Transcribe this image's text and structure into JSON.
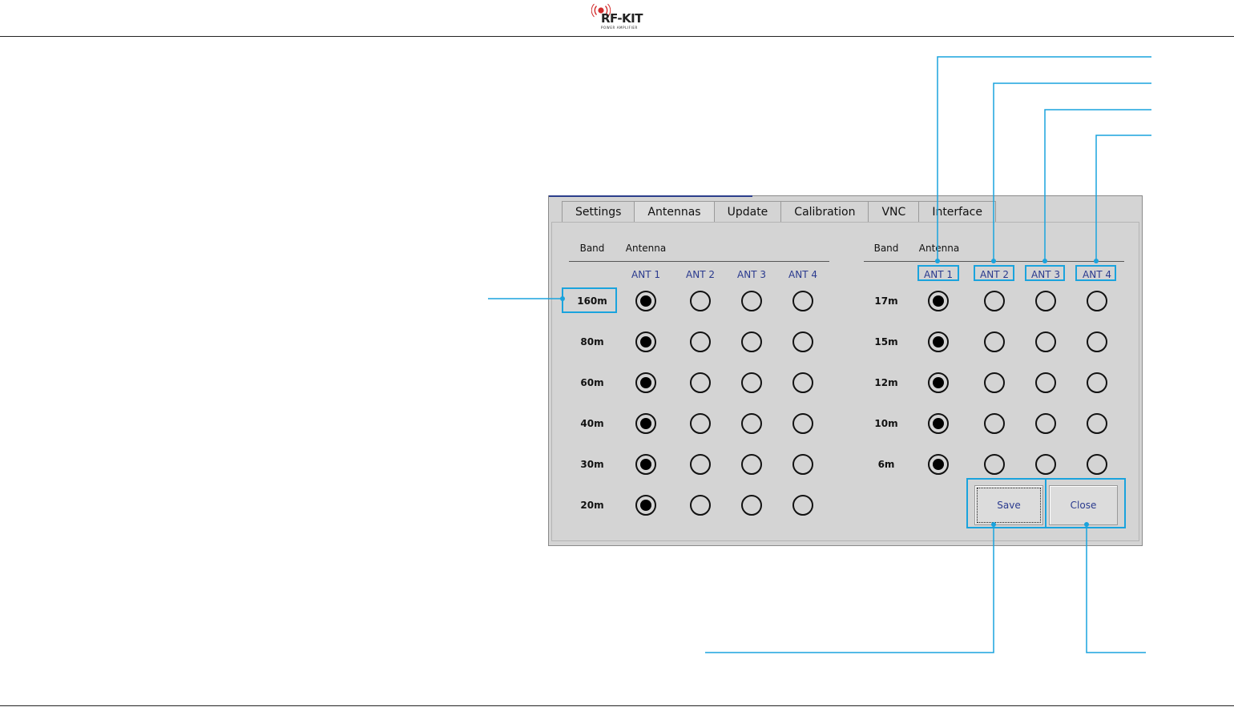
{
  "logo": {
    "brand": "RF-KIT",
    "tagline": "POWER AMPLIFIER"
  },
  "tabs": [
    "Settings",
    "Antennas",
    "Update",
    "Calibration",
    "VNC",
    "Interface"
  ],
  "active_tab": "Antennas",
  "left_table": {
    "band_header": "Band",
    "antenna_header": "Antenna",
    "antenna_labels": [
      "ANT 1",
      "ANT 2",
      "ANT 3",
      "ANT 4"
    ],
    "rows": [
      {
        "band": "160m",
        "selected": 1
      },
      {
        "band": "80m",
        "selected": 1
      },
      {
        "band": "60m",
        "selected": 1
      },
      {
        "band": "40m",
        "selected": 1
      },
      {
        "band": "30m",
        "selected": 1
      },
      {
        "band": "20m",
        "selected": 1
      }
    ]
  },
  "right_table": {
    "band_header": "Band",
    "antenna_header": "Antenna",
    "antenna_labels": [
      "ANT 1",
      "ANT 2",
      "ANT 3",
      "ANT 4"
    ],
    "rows": [
      {
        "band": "17m",
        "selected": 1
      },
      {
        "band": "15m",
        "selected": 1
      },
      {
        "band": "12m",
        "selected": 1
      },
      {
        "band": "10m",
        "selected": 1
      },
      {
        "band": "6m",
        "selected": 1
      }
    ]
  },
  "buttons": {
    "save": "Save",
    "close": "Close"
  },
  "colors": {
    "callout": "#1aa3dd",
    "label_blue": "#2a3a8e",
    "dialog_bg": "#d4d4d4"
  }
}
